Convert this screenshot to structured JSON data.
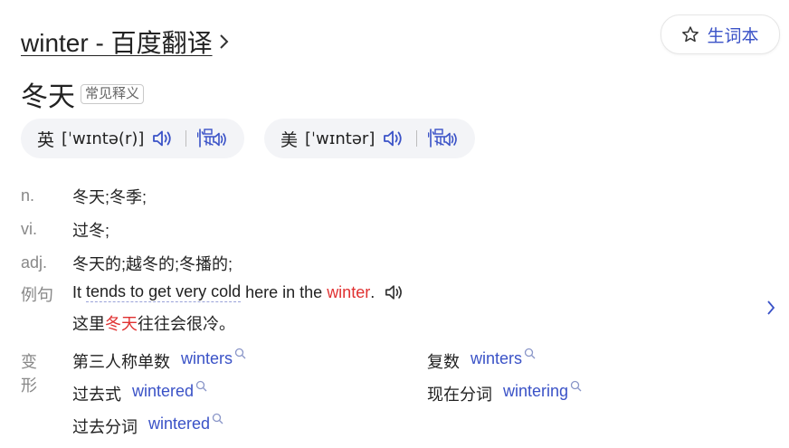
{
  "header": {
    "title": "winter - 百度翻译",
    "vocab_button": "生词本"
  },
  "word": {
    "text": "冬天",
    "tag": "常见释义"
  },
  "pronunciations": [
    {
      "region": "英",
      "ipa": "[ˈwɪntə(r)]"
    },
    {
      "region": "美",
      "ipa": "[ˈwɪntər]"
    }
  ],
  "definitions": [
    {
      "pos": "n.",
      "meaning": "冬天;冬季;"
    },
    {
      "pos": "vi.",
      "meaning": "过冬;"
    },
    {
      "pos": "adj.",
      "meaning": "冬天的;越冬的;冬播的;"
    }
  ],
  "example": {
    "label": "例句",
    "en_before": "It ",
    "en_dashed": "tends to get very cold",
    "en_mid": " here in the ",
    "en_highlight": "winter",
    "en_after": ".",
    "zh_before": "这里",
    "zh_highlight": "冬天",
    "zh_after": "往往会很冷。"
  },
  "forms": {
    "label": "变形",
    "items": [
      {
        "label": "第三人称单数",
        "value": "winters"
      },
      {
        "label": "复数",
        "value": "winters"
      },
      {
        "label": "过去式",
        "value": "wintered"
      },
      {
        "label": "现在分词",
        "value": "wintering"
      },
      {
        "label": "过去分词",
        "value": "wintered"
      }
    ]
  },
  "colors": {
    "accent": "#3a52c7",
    "highlight": "#e03131",
    "muted": "#888888",
    "pill_bg": "#f3f4f7"
  },
  "icons": [
    "chevron-right-icon",
    "star-icon",
    "speaker-icon",
    "slow-speaker-icon",
    "magnifier-icon"
  ]
}
